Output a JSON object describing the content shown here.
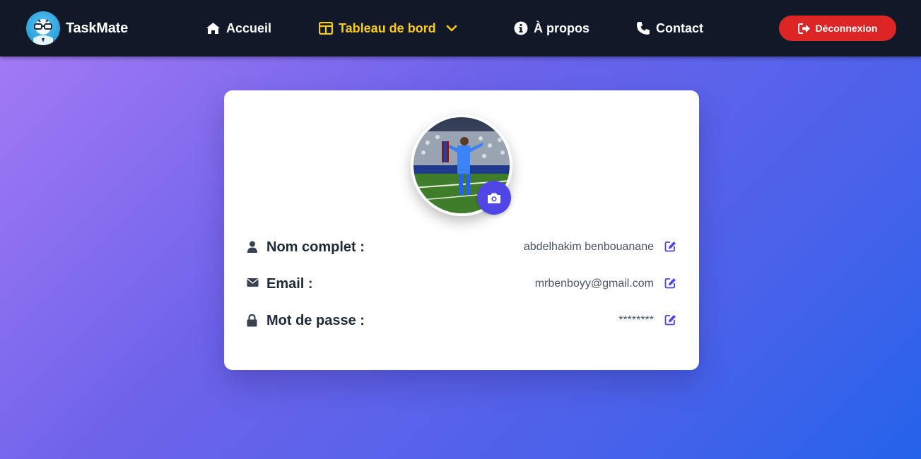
{
  "brand": {
    "name": "TaskMate"
  },
  "nav": {
    "accueil": "Accueil",
    "tableau": "Tableau de bord",
    "apropos": "À propos",
    "contact": "Contact",
    "logout": "Déconnexion"
  },
  "profile": {
    "name_label": "Nom complet :",
    "name_value": "abdelhakim benbouanane",
    "email_label": "Email :",
    "email_value": "mrbenboyy@gmail.com",
    "password_label": "Mot de passe :",
    "password_value": "********"
  },
  "colors": {
    "navbar": "#111827",
    "active_nav": "#facc15",
    "logout": "#dc2626",
    "accent": "#4f46e5"
  },
  "icons": [
    "home-icon",
    "dashboard-icon",
    "chevron-down-icon",
    "info-icon",
    "phone-icon",
    "logout-icon",
    "camera-icon",
    "user-icon",
    "envelope-icon",
    "lock-icon",
    "edit-icon"
  ]
}
